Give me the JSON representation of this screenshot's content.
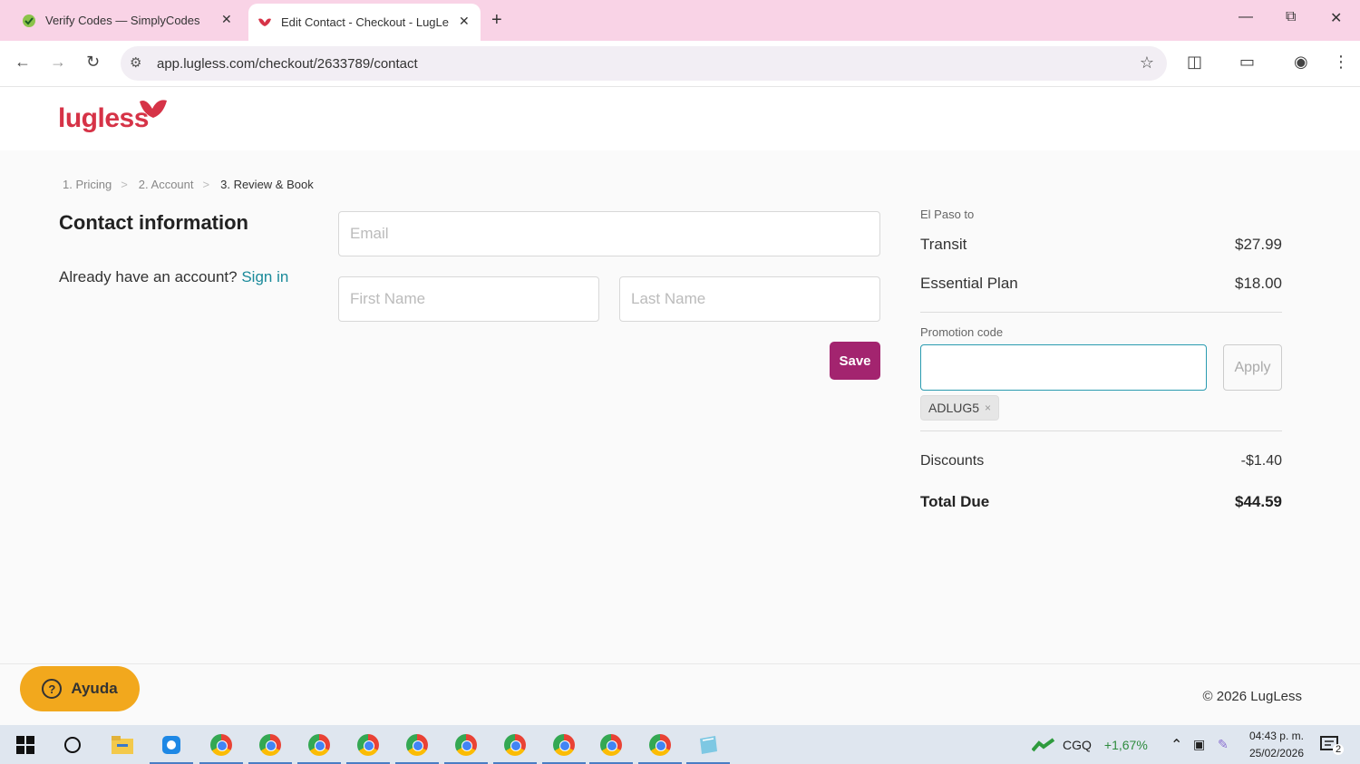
{
  "browser": {
    "tabs": [
      {
        "title": "Verify Codes — SimplyCodes",
        "close": "✕"
      },
      {
        "title": "Edit Contact - Checkout - LugLess",
        "close": "✕"
      }
    ],
    "new_tab": "+",
    "url": "app.lugless.com/checkout/2633789/contact"
  },
  "site": {
    "logo": "lugless",
    "breadcrumbs": [
      "1. Pricing",
      "2. Account",
      "3. Review & Book"
    ],
    "breadcrumb_sep": ">"
  },
  "contact": {
    "heading": "Contact information",
    "have_account": "Already have an account?",
    "sign_in": "Sign in",
    "email_placeholder": "Email",
    "first_name_placeholder": "First Name",
    "last_name_placeholder": "Last Name",
    "save_label": "Save"
  },
  "summary": {
    "route": "El Paso to",
    "items": [
      {
        "label": "Transit",
        "amount": "$27.99"
      },
      {
        "label": "Essential Plan",
        "amount": "$18.00"
      }
    ],
    "promo_label": "Promotion code",
    "promo_value": "",
    "apply_label": "Apply",
    "applied_code": "ADLUG5",
    "chip_remove": "×",
    "discounts_label": "Discounts",
    "discounts_amount": "-$1.40",
    "total_label": "Total Due",
    "total_amount": "$44.59"
  },
  "footer": {
    "help_label": "Ayuda",
    "help_icon": "?",
    "copyright": "© 2026 LugLess"
  },
  "taskbar": {
    "ticker": "CGQ",
    "ticker_change": "+1,67%",
    "time": "04:43 p. m.",
    "date": "25/02/2026",
    "notifications": "2"
  }
}
